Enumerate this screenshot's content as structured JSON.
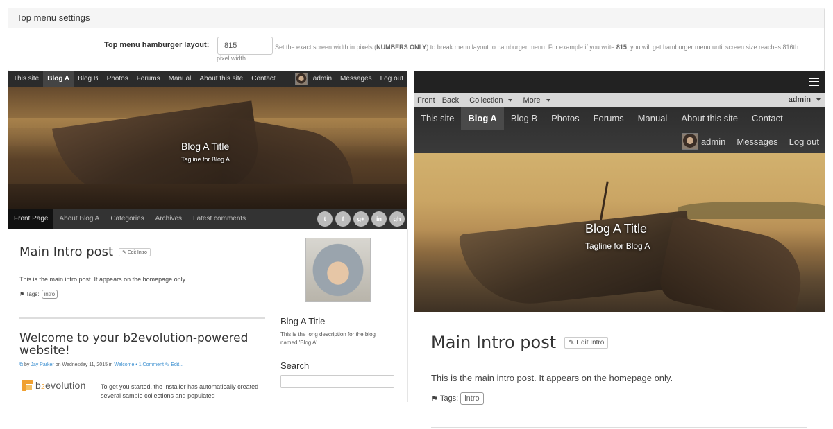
{
  "settings": {
    "header": "Top menu settings",
    "label": "Top menu hamburger layout:",
    "value": "815",
    "help_pre": "Set the exact screen width in pixels (",
    "help_bold1": "NUMBERS ONLY",
    "help_mid": ") to break menu layout to hamburger menu. For example if you write ",
    "help_bold2": "815",
    "help_post": ", you will get hamburger menu until screen size reaches 816th",
    "help_wrap": "pixel width."
  },
  "left": {
    "nav": [
      "This site",
      "Blog A",
      "Blog B",
      "Photos",
      "Forums",
      "Manual",
      "About this site",
      "Contact"
    ],
    "nav_right": [
      "admin",
      "Messages",
      "Log out"
    ],
    "hero_title": "Blog A Title",
    "hero_tagline": "Tagline for Blog A",
    "subnav": [
      "Front Page",
      "About Blog A",
      "Categories",
      "Archives",
      "Latest comments"
    ],
    "social": [
      "t",
      "f",
      "g+",
      "in",
      "gh"
    ],
    "post1_title": "Main Intro post",
    "edit_intro": "Edit Intro",
    "post1_text": "This is the main intro post. It appears on the homepage only.",
    "tags_label": "Tags:",
    "tag": "intro",
    "post2_title": "Welcome to your b2evolution-powered website!",
    "meta_by": "by",
    "meta_author": "Jay Parker",
    "meta_on": "on Wednesday 11, 2015 in",
    "meta_cat": "Welcome",
    "meta_comment": "• 1 Comment",
    "meta_edit": "Edit...",
    "logo_b": "b",
    "logo_2": "2",
    "logo_rest": "evolution",
    "logo_desc": "To get you started, the installer has automatically created several sample collections and populated",
    "side_title": "Blog A Title",
    "side_desc": "This is the long description for the blog named 'Blog A'.",
    "side_search": "Search"
  },
  "right": {
    "evobar": [
      "Front",
      "Back",
      "Collection",
      "More"
    ],
    "evobar_user": "admin",
    "nav": [
      "This site",
      "Blog A",
      "Blog B",
      "Photos",
      "Forums",
      "Manual",
      "About this site",
      "Contact"
    ],
    "nav_right": [
      "admin",
      "Messages",
      "Log out"
    ],
    "hero_title": "Blog A Title",
    "hero_tagline": "Tagline for Blog A",
    "post_title": "Main Intro post",
    "edit_intro": "Edit Intro",
    "post_text": "This is the main intro post. It appears on the homepage only.",
    "tags_label": "Tags:",
    "tag": "intro"
  }
}
